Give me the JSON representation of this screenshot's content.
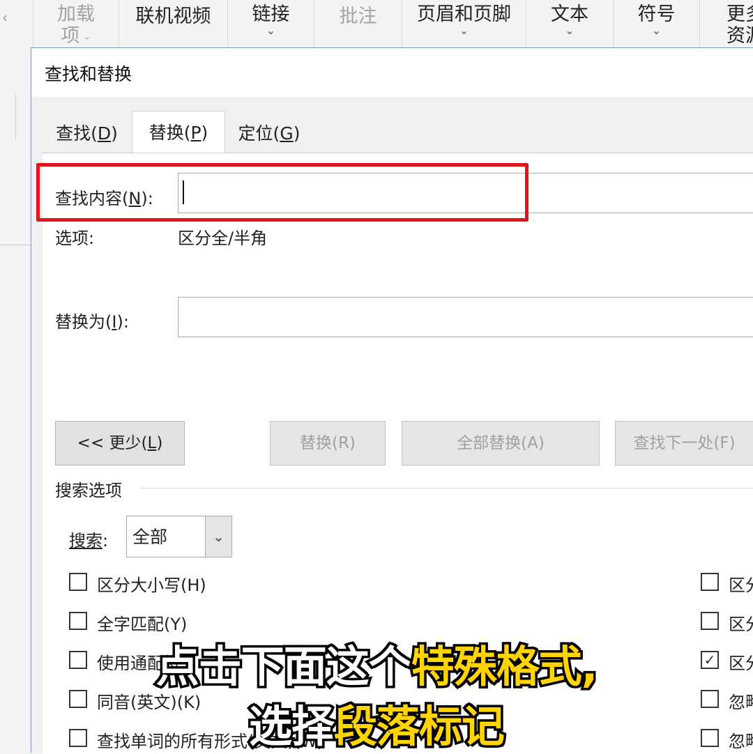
{
  "ribbon": {
    "groups": [
      {
        "line1": "加载",
        "line2": "项",
        "disabled": true
      },
      {
        "label": "联机视频"
      },
      {
        "label": "链接"
      },
      {
        "label": "批注",
        "disabled": true
      },
      {
        "label": "页眉和页脚"
      },
      {
        "label": "文本"
      },
      {
        "label": "符号"
      },
      {
        "line1": "更多",
        "line2": "资源"
      }
    ]
  },
  "dialog": {
    "title": "查找和替换",
    "tabs": [
      {
        "text": "查找(",
        "key": "D",
        "close": ")"
      },
      {
        "text": "替换(",
        "key": "P",
        "close": ")"
      },
      {
        "text": "定位(",
        "key": "G",
        "close": ")"
      }
    ],
    "find": {
      "label_pre": "查找内容(",
      "label_key": "N",
      "label_post": "):",
      "value": ""
    },
    "options": {
      "label": "选项:",
      "value": "区分全/半角"
    },
    "replace": {
      "label_pre": "替换为(",
      "label_key": "I",
      "label_post": "):",
      "value": ""
    },
    "buttons": {
      "less": {
        "pre": "<< 更少(",
        "key": "L",
        "post": ")"
      },
      "replace": "替换(R)",
      "replace_all": "全部替换(A)",
      "find_next": "查找下一处(F)"
    },
    "search_options": {
      "title": "搜索选项",
      "search_label_pre": "搜索",
      "search_label_post": ":",
      "search_value": "全部",
      "left_checks": [
        {
          "label": "区分大小写(H)",
          "checked": false
        },
        {
          "label": "全字匹配(Y)",
          "checked": false
        },
        {
          "label": "使用通配符",
          "checked": false
        },
        {
          "label": "同音(英文)(K)",
          "checked": false
        },
        {
          "label": "查找单词的所有形式(英文)(W)",
          "checked": false
        }
      ],
      "right_checks": [
        {
          "label": "区分",
          "checked": false
        },
        {
          "label": "区分",
          "checked": false
        },
        {
          "label": "区分",
          "checked": true
        },
        {
          "label": "忽略",
          "checked": false
        },
        {
          "label": "忽略",
          "checked": false
        }
      ]
    }
  },
  "caption": {
    "line1_white": "点击下面这个",
    "line1_yellow": "特殊格式,",
    "line2_white": "选择",
    "line2_yellow": "段落标记"
  }
}
